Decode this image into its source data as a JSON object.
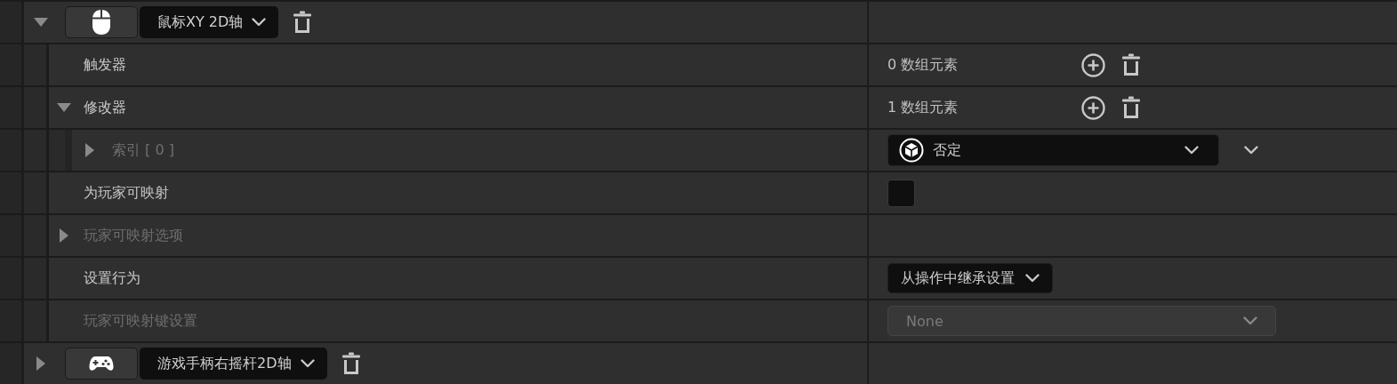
{
  "entries": [
    {
      "kind": "mouse",
      "key": "鼠标XY 2D轴",
      "expanded": true,
      "properties": [
        {
          "kind": "array",
          "label": "触发器",
          "count": "0 数组元素"
        },
        {
          "kind": "array",
          "label": "修改器",
          "count": "1 数组元素",
          "expanded": true,
          "children": [
            {
              "kind": "element",
              "label": "索引 [ 0 ]",
              "disabled": true,
              "expanded": false,
              "value": "否定"
            }
          ]
        },
        {
          "kind": "checkbox",
          "label": "为玩家可映射",
          "checked": false
        },
        {
          "kind": "group",
          "label": "玩家可映射选项",
          "disabled": true,
          "expanded": false
        },
        {
          "kind": "combo",
          "label": "设置行为",
          "value": "从操作中继承设置"
        },
        {
          "kind": "combo",
          "label": "玩家可映射键设置",
          "disabled": true,
          "value": "None"
        }
      ]
    },
    {
      "kind": "gamepad",
      "key": "游戏手柄右摇杆2D轴",
      "expanded": false
    }
  ]
}
